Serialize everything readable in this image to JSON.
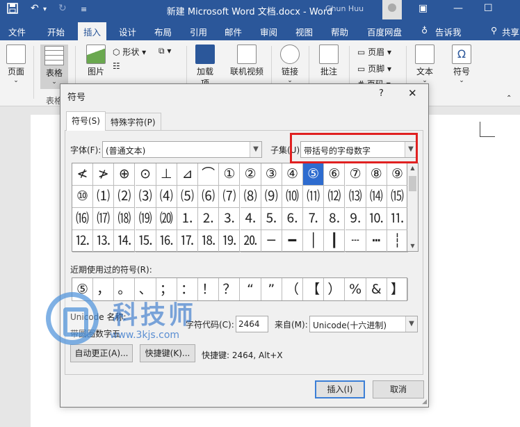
{
  "titlebar": {
    "title": "新建 Microsoft Word 文档.docx  -  Word",
    "account": "Ghun Huu",
    "quick_access": [
      "save-icon",
      "undo-icon",
      "redo-icon",
      "customize-icon"
    ],
    "window_controls": {
      "ribbon_options": "▣",
      "minimize": "—",
      "maximize": "☐"
    }
  },
  "ribbon_tabs": [
    "文件",
    "开始",
    "插入",
    "设计",
    "布局",
    "引用",
    "邮件",
    "审阅",
    "视图",
    "帮助",
    "百度网盘",
    "告诉我",
    "共享"
  ],
  "active_tab": "插入",
  "ribbon": {
    "page": "页面",
    "table": "表格",
    "table_group": "表格",
    "picture": "图片",
    "shapes": "形状",
    "addins": "加载项",
    "online_video": "联机视频",
    "link": "链接",
    "comment": "批注",
    "header": "页眉",
    "footer": "页脚",
    "page_number": "页码",
    "text": "文本",
    "symbol": "符号"
  },
  "dialog": {
    "title": "符号",
    "help": "?",
    "close": "✕",
    "tabs": [
      "符号(S)",
      "特殊字符(P)"
    ],
    "font_label": "字体(F):",
    "font_value": "(普通文本)",
    "subset_label": "子集(U):",
    "subset_value": "带括号的字母数字",
    "symbols": [
      "≮",
      "≯",
      "⊕",
      "⊙",
      "⊥",
      "⊿",
      "⌒",
      "①",
      "②",
      "③",
      "④",
      "⑤",
      "⑥",
      "⑦",
      "⑧",
      "⑨",
      "⑩",
      "⑴",
      "⑵",
      "⑶",
      "⑷",
      "⑸",
      "⑹",
      "⑺",
      "⑻",
      "⑼",
      "⑽",
      "⑾",
      "⑿",
      "⒀",
      "⒁",
      "⒂",
      "⒃",
      "⒄",
      "⒅",
      "⒆",
      "⒇",
      "⒈",
      "⒉",
      "⒊",
      "⒋",
      "⒌",
      "⒍",
      "⒎",
      "⒏",
      "⒐",
      "⒑",
      "⒒",
      "⒓",
      "⒔",
      "⒕",
      "⒖",
      "⒗",
      "⒘",
      "⒙",
      "⒚",
      "⒛",
      "─",
      "━",
      "│",
      "┃",
      "┄",
      "┅",
      "┆"
    ],
    "selected_symbol": "⑤",
    "recent_label": "近期使用过的符号(R):",
    "recent_symbols": [
      "⑤",
      "，",
      "。",
      "、",
      "；",
      "：",
      "！",
      "？",
      "“",
      "”",
      "（",
      "【",
      "）",
      "%",
      "&",
      "】"
    ],
    "unicode_name_label": "Unicode 名称:",
    "unicode_name": "带圆圈数字五",
    "char_code_label": "字符代码(C):",
    "char_code": "2464",
    "from_label": "来自(M):",
    "from_value": "Unicode(十六进制)",
    "autocorrect_button": "自动更正(A)...",
    "shortcut_button": "快捷键(K)...",
    "shortcut_text": "快捷键: 2464, Alt+X",
    "insert_button": "插入(I)",
    "cancel_button": "取消"
  },
  "watermark": {
    "brand": "科技师",
    "url": "www.3kjs.com"
  },
  "colors": {
    "word_blue": "#2b579a",
    "selection": "#2e6ccf",
    "highlight_box": "#e02020"
  }
}
